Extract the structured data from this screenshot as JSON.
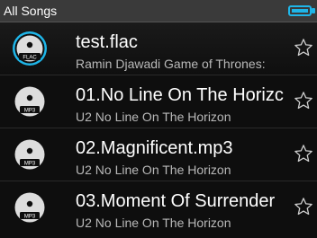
{
  "header": {
    "title": "All Songs",
    "battery_icon": "battery-icon"
  },
  "songs": [
    {
      "title": "test.flac",
      "subtitle": "Ramin Djawadi Game of Thrones:",
      "format": "FLAC",
      "selected": true
    },
    {
      "title": "01.No Line On The Horizc",
      "subtitle": "U2 No Line On The Horizon",
      "format": "MP3",
      "selected": false
    },
    {
      "title": "02.Magnificent.mp3",
      "subtitle": "U2 No Line On The Horizon",
      "format": "MP3",
      "selected": false
    },
    {
      "title": "03.Moment Of Surrender",
      "subtitle": "U2 No Line On The Horizon",
      "format": "MP3",
      "selected": false
    }
  ],
  "colors": {
    "accent": "#1fb6e9",
    "header_bg": "#3a3a3a",
    "background": "#0e0e0e"
  }
}
